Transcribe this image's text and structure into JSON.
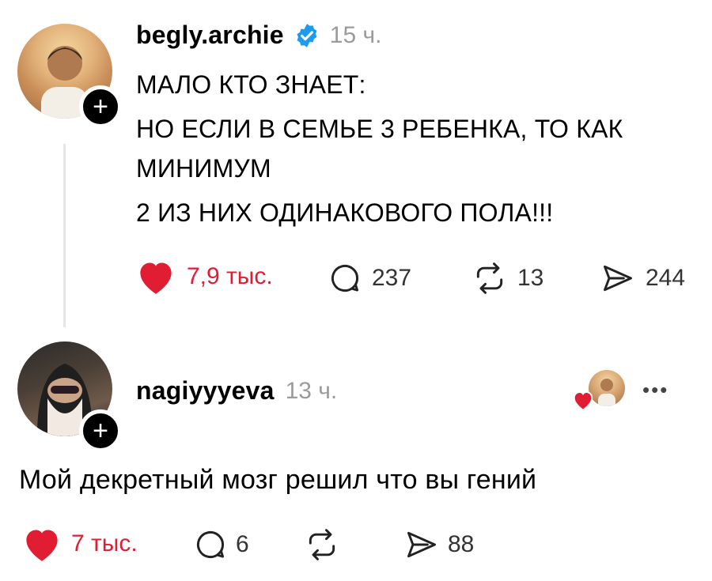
{
  "post": {
    "username": "begly.archie",
    "time": "15 ч.",
    "lines": [
      "МАЛО КТО ЗНАЕТ:",
      "НО ЕСЛИ В СЕМЬЕ 3 РЕБЕНКА, ТО КАК",
      "МИНИМУМ",
      "2 ИЗ НИХ ОДИНАКОВОГО ПОЛА!!!"
    ],
    "likes": "7,9 тыс.",
    "comments": "237",
    "reposts": "13",
    "shares": "244"
  },
  "reply": {
    "username": "nagiyyyeva",
    "time": "13 ч.",
    "text": "Мой декретный мозг решил что вы гений",
    "likes": "7 тыс.",
    "comments": "6",
    "shares": "88",
    "more_label": "•••"
  },
  "colors": {
    "like_red": "#e11d33",
    "verified_blue": "#1d9bf0",
    "muted": "#9b9b9b"
  },
  "icons": [
    "heart-icon",
    "comment-icon",
    "repost-icon",
    "share-icon",
    "verified-icon",
    "plus-icon",
    "more-icon"
  ]
}
